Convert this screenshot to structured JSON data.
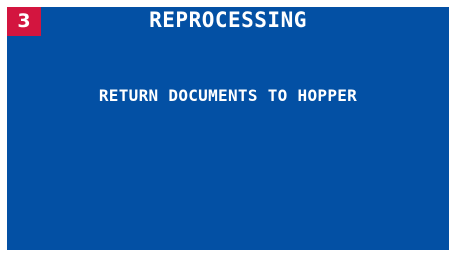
{
  "screen": {
    "badge_number": "3",
    "title": "REPROCESSING",
    "message": "RETURN DOCUMENTS TO HOPPER",
    "colors": {
      "background": "#0350a4",
      "badge": "#d3153f",
      "text": "#ffffff"
    }
  }
}
